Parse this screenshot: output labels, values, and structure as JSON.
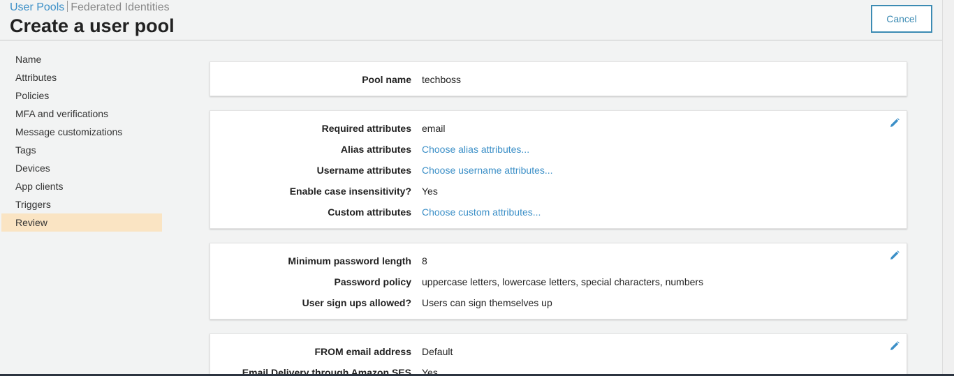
{
  "header": {
    "crumb_user_pools": "User Pools",
    "crumb_federated": "Federated Identities",
    "title": "Create a user pool",
    "cancel_label": "Cancel"
  },
  "sidebar": {
    "items": [
      {
        "label": "Name"
      },
      {
        "label": "Attributes"
      },
      {
        "label": "Policies"
      },
      {
        "label": "MFA and verifications"
      },
      {
        "label": "Message customizations"
      },
      {
        "label": "Tags"
      },
      {
        "label": "Devices"
      },
      {
        "label": "App clients"
      },
      {
        "label": "Triggers"
      },
      {
        "label": "Review"
      }
    ],
    "active": "Review"
  },
  "cards": [
    {
      "rows": [
        {
          "label": "Pool name",
          "value": "techboss"
        }
      ]
    },
    {
      "rows": [
        {
          "label": "Required attributes",
          "value": "email"
        },
        {
          "label": "Alias attributes",
          "value": "Choose alias attributes..."
        },
        {
          "label": "Username attributes",
          "value": "Choose username attributes..."
        },
        {
          "label": "Enable case insensitivity?",
          "value": "Yes"
        },
        {
          "label": "Custom attributes",
          "value": "Choose custom attributes..."
        }
      ]
    },
    {
      "rows": [
        {
          "label": "Minimum password length",
          "value": "8"
        },
        {
          "label": "Password policy",
          "value": "uppercase letters, lowercase letters, special characters, numbers"
        },
        {
          "label": "User sign ups allowed?",
          "value": "Users can sign themselves up"
        }
      ]
    },
    {
      "rows": [
        {
          "label": "FROM email address",
          "value": "Default"
        },
        {
          "label": "Email Delivery through Amazon SES",
          "value": "Yes"
        }
      ]
    }
  ],
  "colors": {
    "link": "#3b8fc7",
    "active_nav": "#fae4c3",
    "cancel_border": "#3c8bb3"
  }
}
